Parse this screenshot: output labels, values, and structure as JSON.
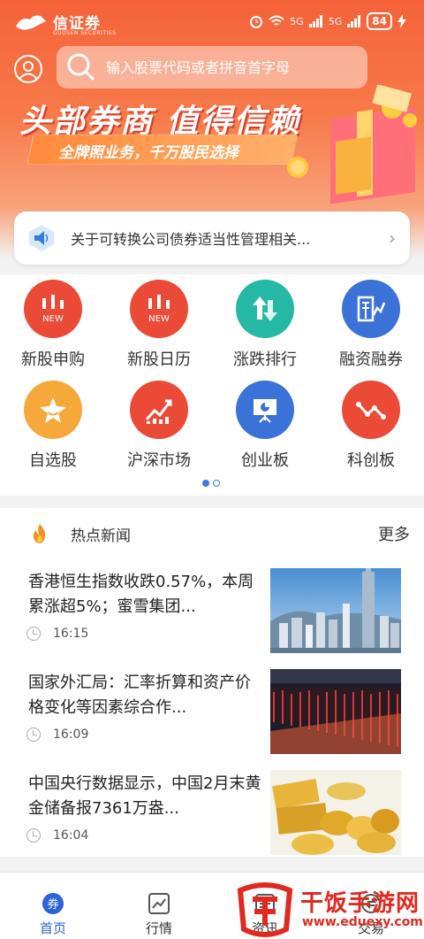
{
  "status": {
    "brand": "信证券",
    "brand_sub": "GUOSEN SECURITIES",
    "network": "5G",
    "battery": "84"
  },
  "search": {
    "placeholder": "输入股票代码或者拼音首字母"
  },
  "banner": {
    "headline": "头部券商 值得信赖",
    "subline": "全牌照业务，千万股民选择"
  },
  "notice": {
    "text": "关于可转换公司债券适当性管理相关..."
  },
  "grid": {
    "items": [
      {
        "label": "新股申购",
        "badge": "NEW",
        "icon": "bar-chart-new-icon",
        "color": "#ea4a36"
      },
      {
        "label": "新股日历",
        "badge": "NEW",
        "icon": "bar-chart-new-icon",
        "color": "#ea4a36"
      },
      {
        "label": "涨跌排行",
        "icon": "up-down-arrows-icon",
        "color": "#25b8a4"
      },
      {
        "label": "融资融券",
        "icon": "margin-trading-icon",
        "color": "#3a72d8"
      },
      {
        "label": "自选股",
        "icon": "star-icon",
        "color": "#f6a93a"
      },
      {
        "label": "沪深市场",
        "icon": "trend-chart-icon",
        "color": "#ea4a36"
      },
      {
        "label": "创业板",
        "icon": "presentation-board-icon",
        "color": "#3a72d8"
      },
      {
        "label": "科创板",
        "icon": "zigzag-line-icon",
        "color": "#ea4a36"
      }
    ]
  },
  "news": {
    "title": "热点新闻",
    "more": "更多",
    "items": [
      {
        "text": "香港恒生指数收跌0.57%，本周累涨超5%；蜜雪集团...",
        "time": "16:15"
      },
      {
        "text": "国家外汇局：汇率折算和资产价格变化等因素综合作...",
        "time": "16:09"
      },
      {
        "text": "中国央行数据显示，中国2月末黄金储备报7361万盎...",
        "time": "16:04"
      }
    ]
  },
  "nav": {
    "items": [
      {
        "label": "首页",
        "icon": "coupon-icon"
      },
      {
        "label": "行情",
        "icon": "chart-icon"
      },
      {
        "label": "资讯",
        "icon": "news-icon"
      },
      {
        "label": "交易",
        "icon": "trade-icon"
      }
    ]
  },
  "watermark": {
    "title": "干饭手游网",
    "url": "www.eduexy.com"
  },
  "colors": {
    "brand": "#f5623a",
    "nav_active": "#2a64d6",
    "watermark": "#e12a1f"
  }
}
